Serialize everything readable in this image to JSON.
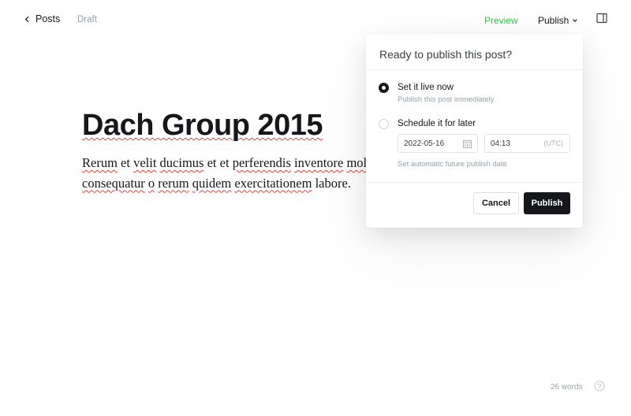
{
  "header": {
    "back_label": "Posts",
    "status": "Draft",
    "preview_label": "Preview",
    "publish_label": "Publish"
  },
  "post": {
    "title": "Dach Group 2015",
    "body": "Rerum et velit ducimus et et perferendis inventore mollitia veniam sequi. Consequatur consequatur o rerum quidem exercitationem labore."
  },
  "publish_menu": {
    "heading": "Ready to publish this post?",
    "option_now": {
      "label": "Set it live now",
      "description": "Publish this post immediately",
      "selected": true
    },
    "option_later": {
      "label": "Schedule it for later",
      "selected": false,
      "date": "2022-05-16",
      "time": "04:13",
      "timezone": "(UTC)",
      "helper": "Set automatic future publish date"
    },
    "cancel_label": "Cancel",
    "publish_label": "Publish"
  },
  "footer": {
    "word_count": "26 words"
  },
  "icons": {
    "back": "chevron-left-icon",
    "dropdown": "chevron-down-icon",
    "sidebar": "sidebar-toggle-icon",
    "calendar": "calendar-icon",
    "help": "help-circle-icon"
  },
  "colors": {
    "accent_green": "#30cf43",
    "primary_dark": "#15171a",
    "muted_text": "#98a0a8"
  }
}
